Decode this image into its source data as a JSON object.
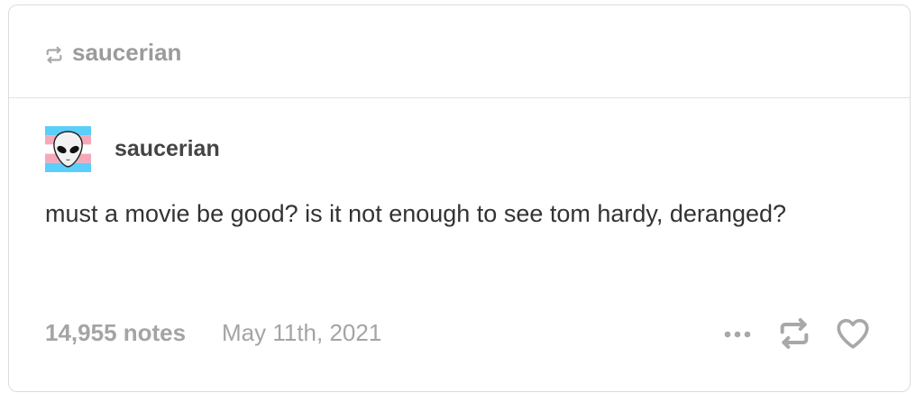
{
  "reblog": {
    "username": "saucerian",
    "icon": "reblog-icon"
  },
  "post": {
    "author": "saucerian",
    "avatar": "alien-on-trans-flag-avatar",
    "body": "must a movie be good? is it not enough to see tom hardy, deranged?"
  },
  "footer": {
    "notes": "14,955 notes",
    "date": "May 11th, 2021",
    "actions": [
      "more-options-icon",
      "reblog-icon",
      "heart-icon"
    ]
  },
  "colors": {
    "muted_text": "#a4a4a4",
    "body_text": "#333333",
    "border": "#dcdcdc",
    "flag_blue": "#5bcefa",
    "flag_pink": "#f5a9b8",
    "flag_white": "#ffffff"
  }
}
